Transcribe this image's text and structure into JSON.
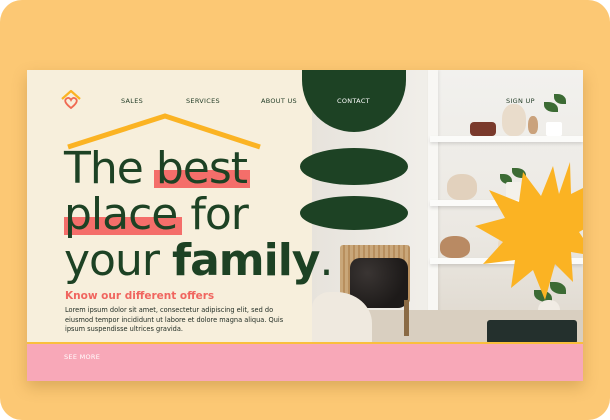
{
  "nav": {
    "items": [
      {
        "label": "SALES"
      },
      {
        "label": "SERVICES"
      },
      {
        "label": "ABOUT US"
      },
      {
        "label": "CONTACT"
      },
      {
        "label": "SIGN UP"
      }
    ]
  },
  "hero": {
    "line1_a": "The",
    "line1_b": "best",
    "line2_a": "place",
    "line2_b": "for",
    "line3_a": "your",
    "line3_b": "family",
    "line3_c": ".",
    "subheading": "Know our different offers",
    "body": "Lorem ipsum dolor sit amet, consectetur adipiscing elit, sed do eiusmod tempor incididunt ut labore et dolore magna aliqua. Quis ipsum suspendisse ultrices gravida."
  },
  "footer": {
    "see_more": "SEE MORE"
  },
  "colors": {
    "frame": "#fcc874",
    "card": "#f7efdc",
    "green": "#1d4224",
    "coral": "#f46e6a",
    "accent_yellow": "#fbb323",
    "footer_pink": "#f8a8b8"
  },
  "icons": {
    "logo": "house-heart-logo",
    "roof": "roof-outline",
    "star": "starburst-shape"
  }
}
